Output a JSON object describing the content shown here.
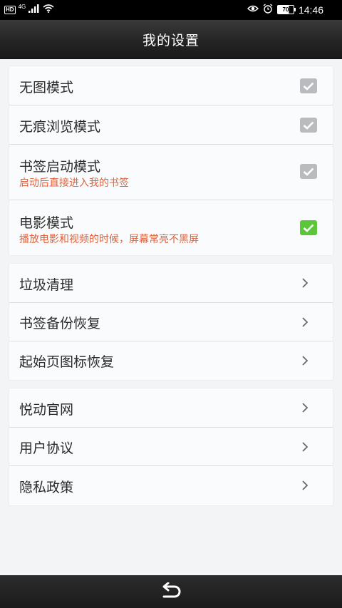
{
  "status_bar": {
    "hd_label": "HD",
    "network_label": "4G",
    "battery_level": "70",
    "time": "14:46",
    "icons": [
      "signal-icon",
      "wifi-icon",
      "eye-icon",
      "alarm-icon",
      "battery-icon"
    ]
  },
  "header": {
    "title": "我的设置"
  },
  "toggles": [
    {
      "label": "无图模式",
      "subtitle": "",
      "checked": false
    },
    {
      "label": "无痕浏览模式",
      "subtitle": "",
      "checked": false
    },
    {
      "label": "书签启动模式",
      "subtitle": "启动后直接进入我的书签",
      "checked": false
    },
    {
      "label": "电影模式",
      "subtitle": "播放电影和视频的时候，屏幕常亮不黑屏",
      "checked": true
    }
  ],
  "tools": [
    {
      "label": "垃圾清理"
    },
    {
      "label": "书签备份恢复"
    },
    {
      "label": "起始页图标恢复"
    }
  ],
  "info": [
    {
      "label": "悦动官网"
    },
    {
      "label": "用户协议"
    },
    {
      "label": "隐私政策"
    }
  ],
  "colors": {
    "accent_checked": "#5cc63a",
    "unchecked": "#b9bbbe",
    "subtitle": "#e0623a"
  },
  "bottom_bar": {
    "back_icon": "back-arrow-icon"
  }
}
